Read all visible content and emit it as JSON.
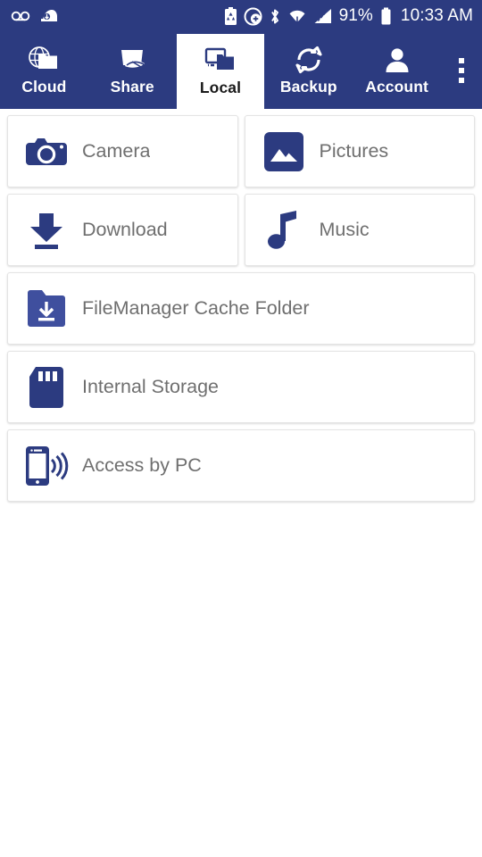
{
  "status_bar": {
    "left_icons": [
      {
        "name": "voicemail-icon",
        "glyph": "voicemail"
      },
      {
        "name": "download-notification-icon",
        "glyph": "download-arrow"
      }
    ],
    "right_icons": [
      {
        "name": "battery-saver-icon",
        "glyph": "battery-recycle"
      },
      {
        "name": "data-saver-icon",
        "glyph": "circle-plus"
      },
      {
        "name": "bluetooth-icon",
        "glyph": "bluetooth"
      },
      {
        "name": "wifi-icon",
        "glyph": "wifi"
      },
      {
        "name": "cellular-signal-icon",
        "glyph": "signal-bars"
      }
    ],
    "battery_percent": "91%",
    "clock": "10:33 AM",
    "background_color": "#2C3B80"
  },
  "tab_bar": {
    "background_color": "#2C3B80",
    "active_tab_index": 2,
    "tabs": [
      {
        "label": "Cloud",
        "icon": "cloud-folder-icon",
        "active": false
      },
      {
        "label": "Share",
        "icon": "share-bag-icon",
        "active": false
      },
      {
        "label": "Local",
        "icon": "local-monitor-folder-icon",
        "active": true
      },
      {
        "label": "Backup",
        "icon": "sync-arrows-icon",
        "active": false
      },
      {
        "label": "Account",
        "icon": "person-icon",
        "active": false
      }
    ],
    "overflow_label": "More options",
    "overflow_icon": "overflow-menu-icon"
  },
  "main": {
    "accent_color": "#2C3B80",
    "icon_light_color": "#3F4F9E",
    "label_color": "#6f6f6f",
    "rows": [
      {
        "layout": "two-column",
        "items": [
          {
            "label": "Camera",
            "icon": "camera-icon"
          },
          {
            "label": "Pictures",
            "icon": "pictures-icon"
          }
        ]
      },
      {
        "layout": "two-column",
        "items": [
          {
            "label": "Download",
            "icon": "download-icon"
          },
          {
            "label": "Music",
            "icon": "music-note-icon"
          }
        ]
      },
      {
        "layout": "full-width",
        "items": [
          {
            "label": "FileManager Cache Folder",
            "icon": "folder-download-icon"
          }
        ]
      },
      {
        "layout": "full-width",
        "items": [
          {
            "label": "Internal Storage",
            "icon": "sd-card-icon"
          }
        ]
      },
      {
        "layout": "full-width",
        "items": [
          {
            "label": "Access by PC",
            "icon": "phone-wireless-icon"
          }
        ]
      }
    ]
  }
}
